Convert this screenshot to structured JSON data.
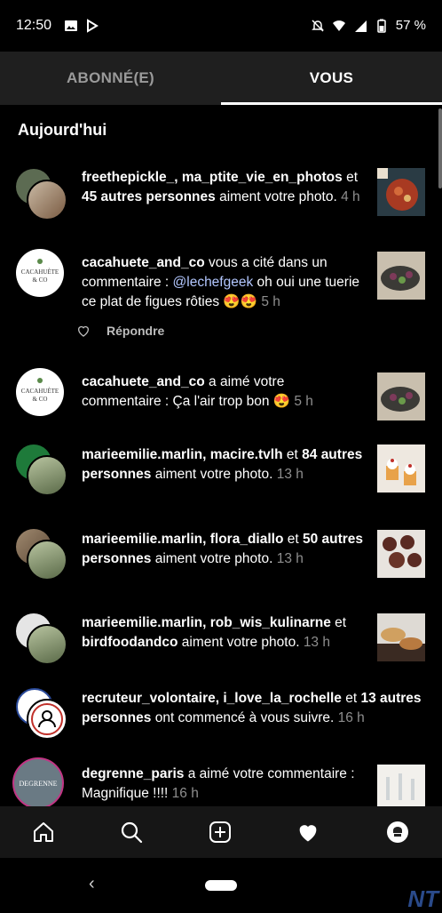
{
  "status": {
    "time": "12:50",
    "battery": "57 %"
  },
  "tabs": {
    "left": "ABONNÉ(E)",
    "right": "VOUS"
  },
  "section_title": "Aujourd'hui",
  "notifications": [
    {
      "b1": "freethepickle_, ma_ptite_vie_en_photos",
      "m1": " et ",
      "b2": "45 autres personnes",
      "m2": " aiment votre photo. ",
      "time": "4 h"
    },
    {
      "b1": "cacahuete_and_co",
      "m1": " vous a cité dans un commentaire : ",
      "mention": "@lechefgeek",
      "m2": " oh oui une tuerie ce plat de figues rôties 😍😍 ",
      "time": "5 h"
    },
    {
      "b1": "cacahuete_and_co",
      "m1": " a aimé votre commentaire : Ça l'air trop bon 😍 ",
      "time": "5 h"
    },
    {
      "b1": "marieemilie.marlin, macire.tvlh",
      "m1": " et ",
      "b2": "84 autres personnes",
      "m2": " aiment votre photo. ",
      "time": "13 h"
    },
    {
      "b1": "marieemilie.marlin, flora_diallo",
      "m1": " et ",
      "b2": "50 autres personnes",
      "m2": " aiment votre photo. ",
      "time": "13 h"
    },
    {
      "b1": "marieemilie.marlin, rob_wis_kulinarne",
      "m1": " et ",
      "b2": "birdfoodandco",
      "m2": " aiment votre photo. ",
      "time": "13 h"
    },
    {
      "b1": "recruteur_volontaire, i_love_la_rochelle",
      "m1": " et ",
      "b2": "13 autres personnes",
      "m2": " ont commencé à vous suivre. ",
      "time": "16 h"
    },
    {
      "b1": "degrenne_paris",
      "m1": " a aimé votre commentaire : Magnifique !!!! ",
      "time": "16 h"
    }
  ],
  "reply": {
    "label": "Répondre"
  },
  "avatars": {
    "cacahuete_line1": "CACAHUÈTE",
    "cacahuete_line2": "& CO",
    "degrenne": "DEGRENNE"
  },
  "watermark": "NT"
}
